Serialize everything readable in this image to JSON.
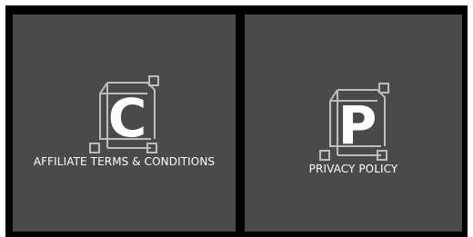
{
  "cards": [
    {
      "letter": "C",
      "label": "AFFILIATE TERMS & CONDITIONS"
    },
    {
      "letter": "P",
      "label": "PRIVACY POLICY"
    }
  ],
  "colors": {
    "background": "#000000",
    "card": "#4a4a4a",
    "text": "#ffffff",
    "icon_outline": "#bdbdbd"
  },
  "icons": [
    "document-c-icon",
    "document-p-icon"
  ]
}
